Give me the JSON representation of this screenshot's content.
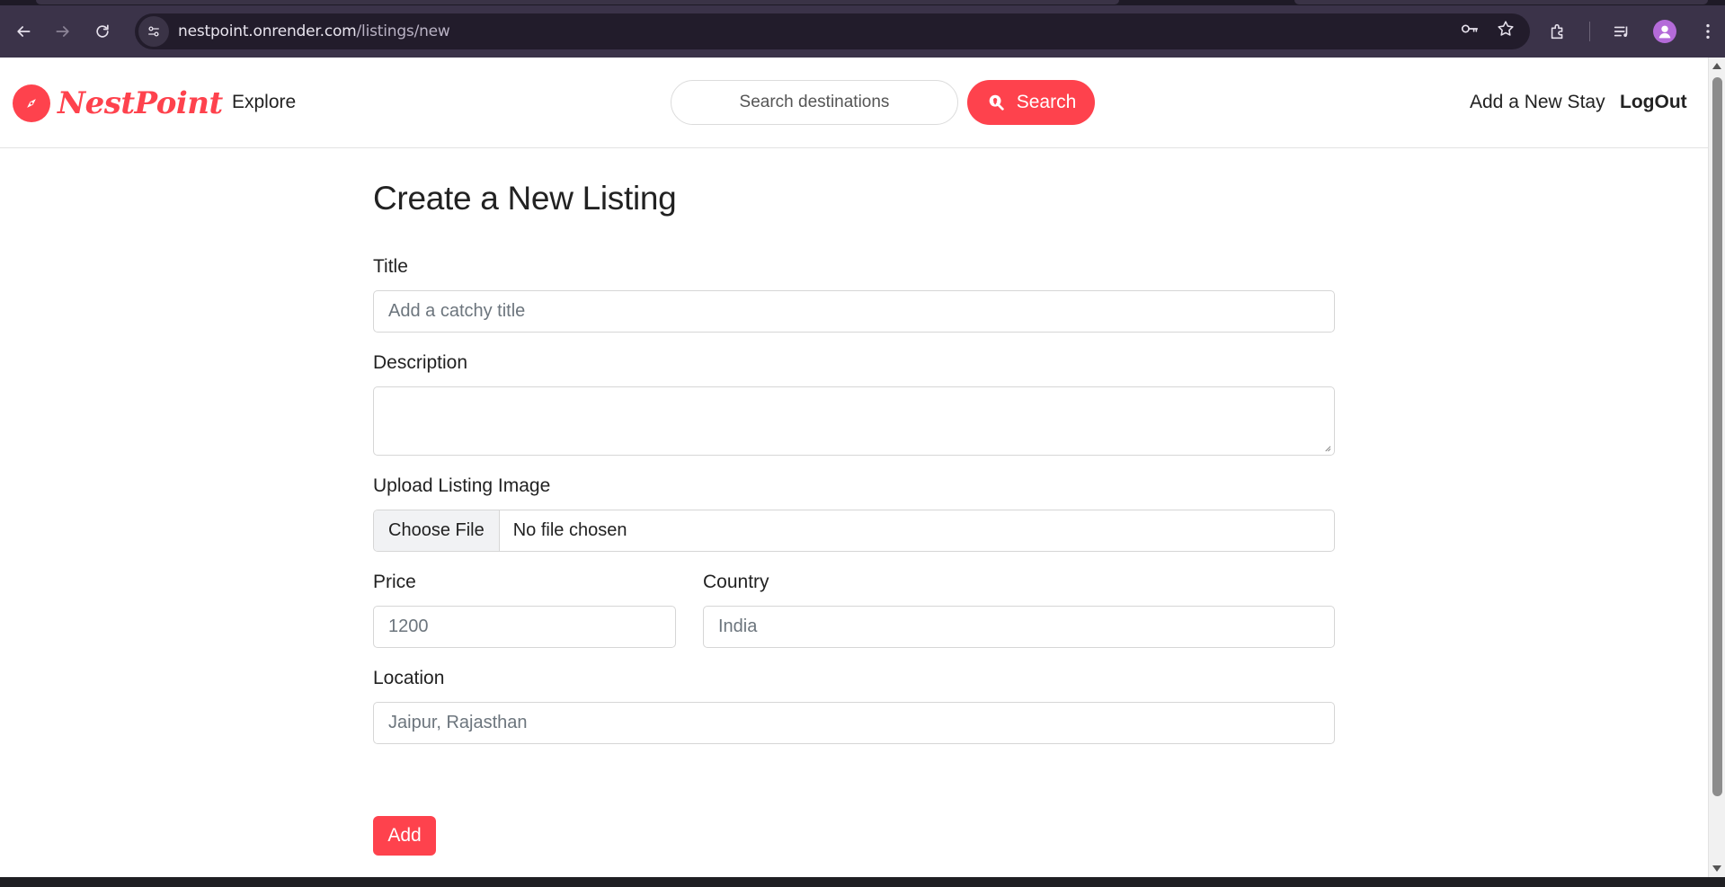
{
  "browser": {
    "url_host": "nestpoint.onrender.com",
    "url_path": "/listings/new"
  },
  "navbar": {
    "brand": "NestPoint",
    "explore": "Explore",
    "search_placeholder": "Search destinations",
    "search_button": "Search",
    "add_stay": "Add a New Stay",
    "logout": "LogOut"
  },
  "form": {
    "heading": "Create a New Listing",
    "title_label": "Title",
    "title_placeholder": "Add a catchy title",
    "description_label": "Description",
    "image_label": "Upload Listing Image",
    "choose_file": "Choose File",
    "no_file": "No file chosen",
    "price_label": "Price",
    "price_placeholder": "1200",
    "country_label": "Country",
    "country_placeholder": "India",
    "location_label": "Location",
    "location_placeholder": "Jaipur, Rajasthan",
    "submit": "Add"
  },
  "colors": {
    "brand": "#fe424d",
    "chrome_bg": "#3b3349",
    "omnibox_bg": "#221c2b"
  }
}
